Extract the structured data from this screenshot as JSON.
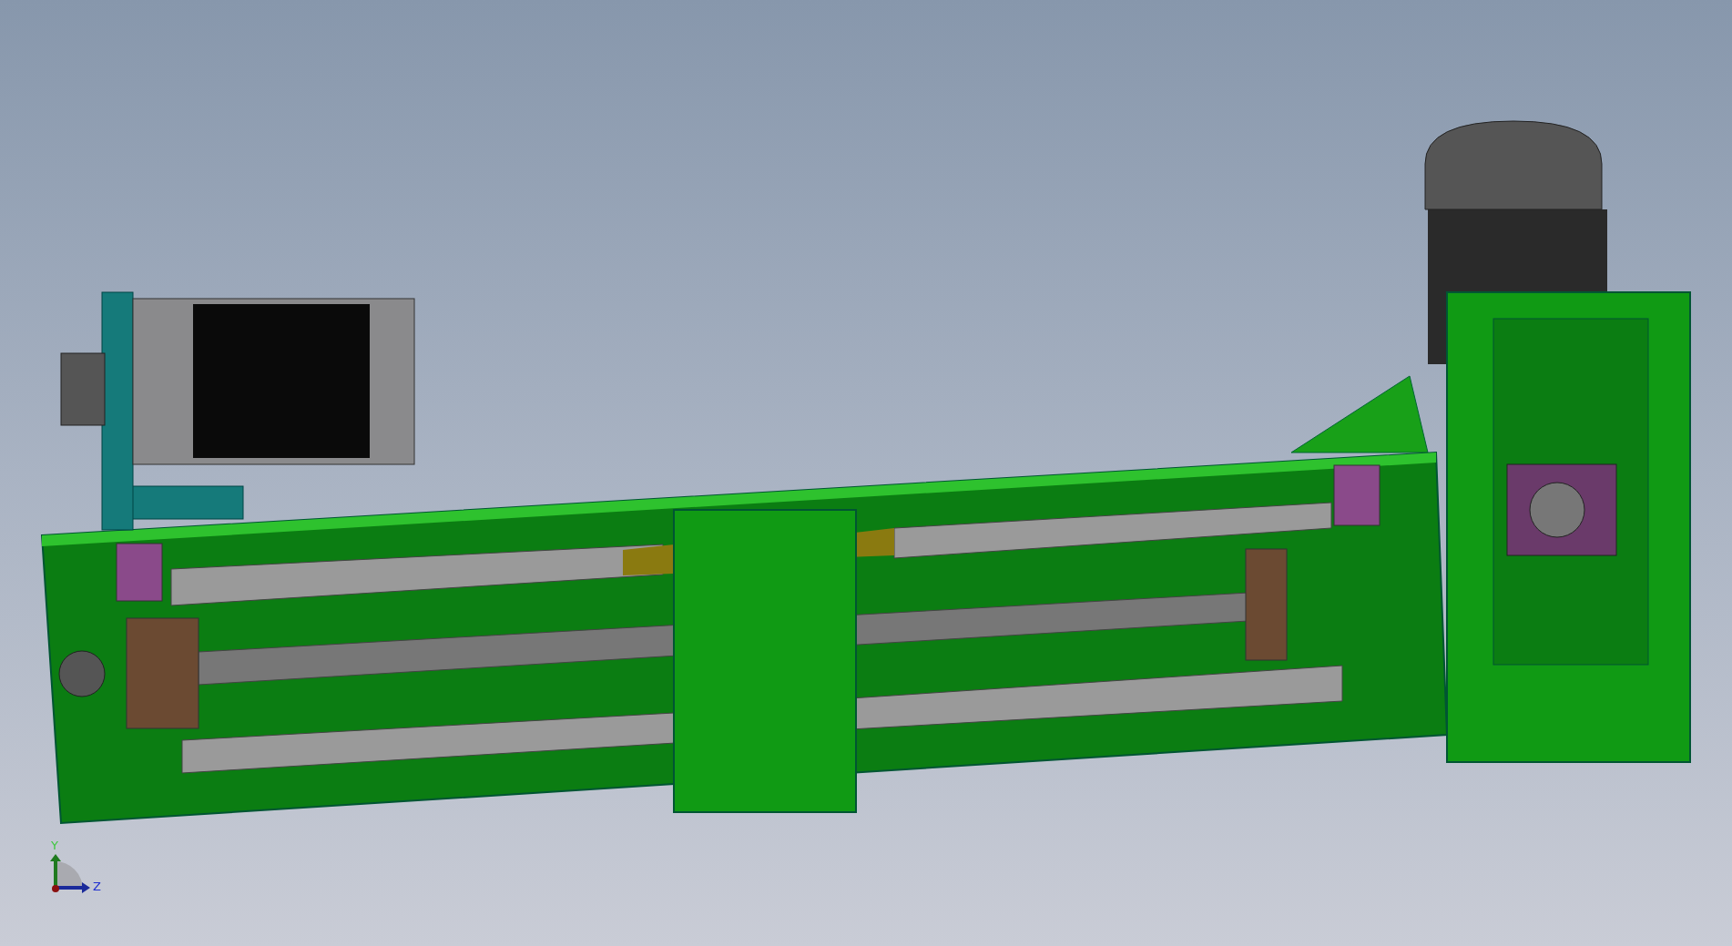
{
  "viewport": {
    "triad": {
      "axes": [
        {
          "kind": "vertical",
          "label": "Y",
          "color": "#1f7a1f"
        },
        {
          "kind": "horizontal",
          "label": "Z",
          "color": "#1a2a9a"
        }
      ]
    }
  }
}
